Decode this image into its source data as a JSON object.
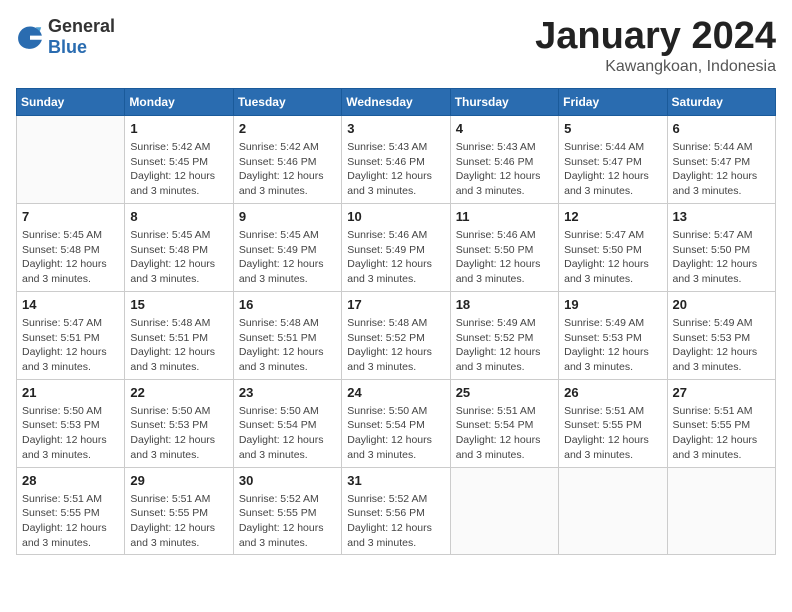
{
  "logo": {
    "general": "General",
    "blue": "Blue"
  },
  "title": {
    "month": "January 2024",
    "location": "Kawangkoan, Indonesia"
  },
  "weekdays": [
    "Sunday",
    "Monday",
    "Tuesday",
    "Wednesday",
    "Thursday",
    "Friday",
    "Saturday"
  ],
  "weeks": [
    [
      {
        "day": "",
        "info": ""
      },
      {
        "day": "1",
        "info": "Sunrise: 5:42 AM\nSunset: 5:45 PM\nDaylight: 12 hours\nand 3 minutes."
      },
      {
        "day": "2",
        "info": "Sunrise: 5:42 AM\nSunset: 5:46 PM\nDaylight: 12 hours\nand 3 minutes."
      },
      {
        "day": "3",
        "info": "Sunrise: 5:43 AM\nSunset: 5:46 PM\nDaylight: 12 hours\nand 3 minutes."
      },
      {
        "day": "4",
        "info": "Sunrise: 5:43 AM\nSunset: 5:46 PM\nDaylight: 12 hours\nand 3 minutes."
      },
      {
        "day": "5",
        "info": "Sunrise: 5:44 AM\nSunset: 5:47 PM\nDaylight: 12 hours\nand 3 minutes."
      },
      {
        "day": "6",
        "info": "Sunrise: 5:44 AM\nSunset: 5:47 PM\nDaylight: 12 hours\nand 3 minutes."
      }
    ],
    [
      {
        "day": "7",
        "info": "Sunrise: 5:45 AM\nSunset: 5:48 PM\nDaylight: 12 hours\nand 3 minutes."
      },
      {
        "day": "8",
        "info": "Sunrise: 5:45 AM\nSunset: 5:48 PM\nDaylight: 12 hours\nand 3 minutes."
      },
      {
        "day": "9",
        "info": "Sunrise: 5:45 AM\nSunset: 5:49 PM\nDaylight: 12 hours\nand 3 minutes."
      },
      {
        "day": "10",
        "info": "Sunrise: 5:46 AM\nSunset: 5:49 PM\nDaylight: 12 hours\nand 3 minutes."
      },
      {
        "day": "11",
        "info": "Sunrise: 5:46 AM\nSunset: 5:50 PM\nDaylight: 12 hours\nand 3 minutes."
      },
      {
        "day": "12",
        "info": "Sunrise: 5:47 AM\nSunset: 5:50 PM\nDaylight: 12 hours\nand 3 minutes."
      },
      {
        "day": "13",
        "info": "Sunrise: 5:47 AM\nSunset: 5:50 PM\nDaylight: 12 hours\nand 3 minutes."
      }
    ],
    [
      {
        "day": "14",
        "info": "Sunrise: 5:47 AM\nSunset: 5:51 PM\nDaylight: 12 hours\nand 3 minutes."
      },
      {
        "day": "15",
        "info": "Sunrise: 5:48 AM\nSunset: 5:51 PM\nDaylight: 12 hours\nand 3 minutes."
      },
      {
        "day": "16",
        "info": "Sunrise: 5:48 AM\nSunset: 5:51 PM\nDaylight: 12 hours\nand 3 minutes."
      },
      {
        "day": "17",
        "info": "Sunrise: 5:48 AM\nSunset: 5:52 PM\nDaylight: 12 hours\nand 3 minutes."
      },
      {
        "day": "18",
        "info": "Sunrise: 5:49 AM\nSunset: 5:52 PM\nDaylight: 12 hours\nand 3 minutes."
      },
      {
        "day": "19",
        "info": "Sunrise: 5:49 AM\nSunset: 5:53 PM\nDaylight: 12 hours\nand 3 minutes."
      },
      {
        "day": "20",
        "info": "Sunrise: 5:49 AM\nSunset: 5:53 PM\nDaylight: 12 hours\nand 3 minutes."
      }
    ],
    [
      {
        "day": "21",
        "info": "Sunrise: 5:50 AM\nSunset: 5:53 PM\nDaylight: 12 hours\nand 3 minutes."
      },
      {
        "day": "22",
        "info": "Sunrise: 5:50 AM\nSunset: 5:53 PM\nDaylight: 12 hours\nand 3 minutes."
      },
      {
        "day": "23",
        "info": "Sunrise: 5:50 AM\nSunset: 5:54 PM\nDaylight: 12 hours\nand 3 minutes."
      },
      {
        "day": "24",
        "info": "Sunrise: 5:50 AM\nSunset: 5:54 PM\nDaylight: 12 hours\nand 3 minutes."
      },
      {
        "day": "25",
        "info": "Sunrise: 5:51 AM\nSunset: 5:54 PM\nDaylight: 12 hours\nand 3 minutes."
      },
      {
        "day": "26",
        "info": "Sunrise: 5:51 AM\nSunset: 5:55 PM\nDaylight: 12 hours\nand 3 minutes."
      },
      {
        "day": "27",
        "info": "Sunrise: 5:51 AM\nSunset: 5:55 PM\nDaylight: 12 hours\nand 3 minutes."
      }
    ],
    [
      {
        "day": "28",
        "info": "Sunrise: 5:51 AM\nSunset: 5:55 PM\nDaylight: 12 hours\nand 3 minutes."
      },
      {
        "day": "29",
        "info": "Sunrise: 5:51 AM\nSunset: 5:55 PM\nDaylight: 12 hours\nand 3 minutes."
      },
      {
        "day": "30",
        "info": "Sunrise: 5:52 AM\nSunset: 5:55 PM\nDaylight: 12 hours\nand 3 minutes."
      },
      {
        "day": "31",
        "info": "Sunrise: 5:52 AM\nSunset: 5:56 PM\nDaylight: 12 hours\nand 3 minutes."
      },
      {
        "day": "",
        "info": ""
      },
      {
        "day": "",
        "info": ""
      },
      {
        "day": "",
        "info": ""
      }
    ]
  ]
}
